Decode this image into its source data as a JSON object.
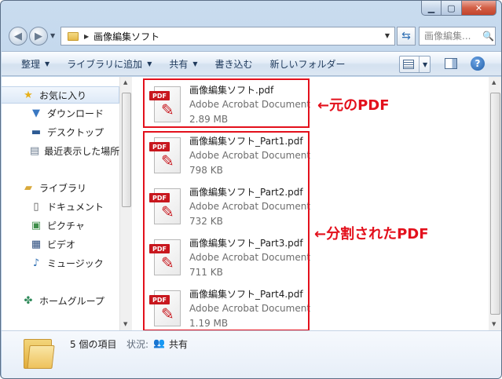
{
  "window": {
    "min_label": "▁",
    "max_label": "▢",
    "close_label": "✕"
  },
  "address_bar": {
    "path": "画像編集ソフト",
    "search_placeholder": "画像編集..."
  },
  "commands": {
    "organize": "整理",
    "add_to_library": "ライブラリに追加",
    "share": "共有",
    "burn": "書き込む",
    "new_folder": "新しいフォルダー"
  },
  "nav_pane": {
    "favorites": {
      "label": "お気に入り",
      "items": [
        "ダウンロード",
        "デスクトップ",
        "最近表示した場所"
      ]
    },
    "libraries": {
      "label": "ライブラリ",
      "items": [
        "ドキュメント",
        "ピクチャ",
        "ビデオ",
        "ミュージック"
      ]
    },
    "homegroup": "ホームグループ"
  },
  "files": [
    {
      "name": "画像編集ソフト.pdf",
      "type": "Adobe Acrobat Document",
      "size": "2.89 MB"
    },
    {
      "name": "画像編集ソフト_Part1.pdf",
      "type": "Adobe Acrobat Document",
      "size": "798 KB"
    },
    {
      "name": "画像編集ソフト_Part2.pdf",
      "type": "Adobe Acrobat Document",
      "size": "732 KB"
    },
    {
      "name": "画像編集ソフト_Part3.pdf",
      "type": "Adobe Acrobat Document",
      "size": "711 KB"
    },
    {
      "name": "画像編集ソフト_Part4.pdf",
      "type": "Adobe Acrobat Document",
      "size": "1.19 MB"
    }
  ],
  "pdf_icon_tag": "PDF",
  "annotations": {
    "original": "←元のPDF",
    "split": "←分割されたPDF"
  },
  "details": {
    "count": "5 個の項目",
    "state_label": "状況:",
    "state_value": "共有"
  },
  "colors": {
    "annotation_red": "#e3101c",
    "pdf_red": "#c8171e",
    "command_text": "#1e395b"
  }
}
